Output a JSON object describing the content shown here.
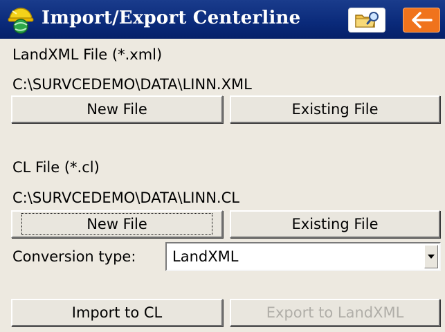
{
  "window": {
    "title": "Import/Export Centerline",
    "app_icon": "helmet-globe-icon",
    "folder_button_icon": "folder-search-icon",
    "back_button_icon": "arrow-left-icon",
    "title_bg": "#0a2a7a",
    "back_color": "#f0731c"
  },
  "landxml": {
    "label": "LandXML File (*.xml)",
    "path": "C:\\SURVCEDEMO\\DATA\\LINN.XML",
    "new_file_label": "New File",
    "existing_file_label": "Existing File"
  },
  "cl": {
    "label": "CL File (*.cl)",
    "path": "C:\\SURVCEDEMO\\DATA\\LINN.CL",
    "new_file_label": "New File",
    "existing_file_label": "Existing File"
  },
  "conversion": {
    "label": "Conversion type:",
    "value": "LandXML"
  },
  "actions": {
    "import_label": "Import to CL",
    "export_label": "Export to LandXML"
  }
}
